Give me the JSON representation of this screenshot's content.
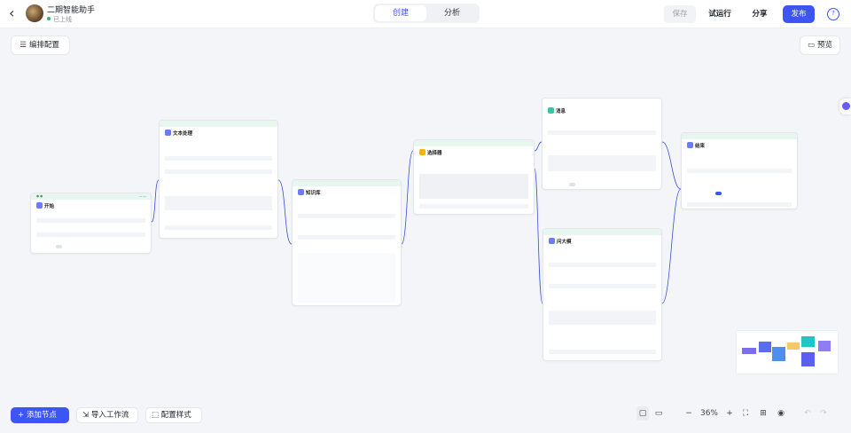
{
  "header": {
    "app_name": "二期智能助手",
    "app_status": "已上线",
    "tabs": [
      "创建",
      "分析"
    ],
    "save_label": "保存",
    "try_label": "试运行",
    "share_label": "分享",
    "publish_label": "发布"
  },
  "canvas": {
    "arrange_label": "编排配置",
    "preview_label": "预览",
    "add_node_label": "添加节点",
    "import_label": "导入工作流",
    "config_style_label": "配置样式",
    "zoom": "36%"
  },
  "nodes": {
    "start": {
      "title": "开始"
    },
    "text": {
      "title": "文本处理"
    },
    "knowledge": {
      "title": "知识库"
    },
    "condition": {
      "title": "选择器"
    },
    "message": {
      "title": "消息"
    },
    "question": {
      "title": "问大模"
    },
    "end": {
      "title": "结束"
    }
  },
  "colors": {
    "accent": "#3d55f5",
    "edge": "#3b4ed8",
    "minimap": [
      "#7c6cf0",
      "#4d8ff0",
      "#f5c86a",
      "#23c4c8",
      "#5b5ff0",
      "#8f7df5"
    ]
  }
}
